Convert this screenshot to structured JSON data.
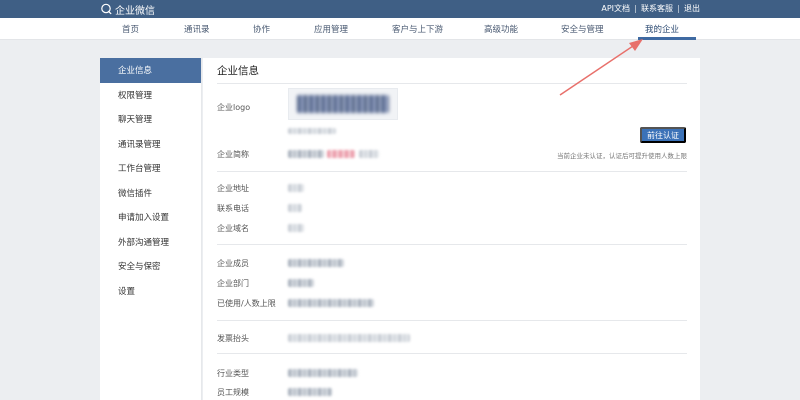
{
  "topbar": {
    "brand": "企业微信",
    "links": [
      "API文档",
      "联系客服",
      "退出"
    ]
  },
  "nav": {
    "items": [
      "首页",
      "通讯录",
      "协作",
      "应用管理",
      "客户与上下游",
      "高级功能",
      "安全与管理",
      "我的企业"
    ],
    "active_index": 7
  },
  "sidebar": {
    "items": [
      "企业信息",
      "权限管理",
      "聊天管理",
      "通讯录管理",
      "工作台管理",
      "微信插件",
      "申请加入设置",
      "外部沟通管理",
      "安全与保密",
      "设置"
    ],
    "active_index": 0
  },
  "panel": {
    "title": "企业信息",
    "labels": {
      "logo": "企业logo",
      "short_name": "企业简称",
      "address": "企业地址",
      "phone": "联系电话",
      "domain": "企业域名",
      "members": "企业成员",
      "departments": "企业部门",
      "usage": "已使用/人数上限",
      "invoice": "发票抬头",
      "industry": "行业类型",
      "scale": "员工规模"
    },
    "verify_button": "前往认证",
    "verify_hint": "当前企业未认证，认证后可提升使用人数上限"
  },
  "colors": {
    "topbar": "#3f5f85",
    "accent": "#3b72b8",
    "sidebar_active": "#4a6fa0",
    "arrow": "#e8706b"
  }
}
